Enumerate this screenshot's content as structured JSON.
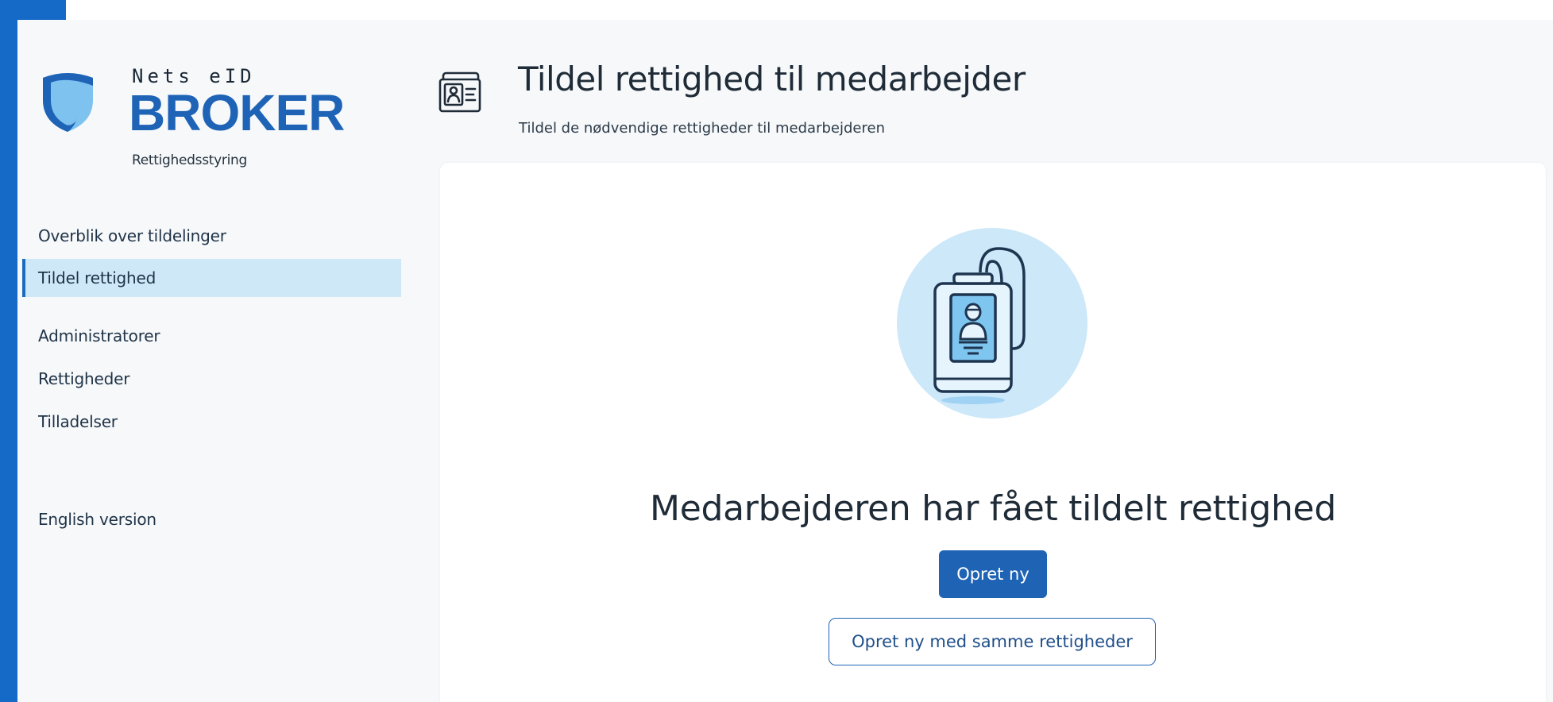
{
  "logo": {
    "top_text": "Nets eID",
    "main_text": "BROKER",
    "sub_text": "Rettighedsstyring",
    "icon": "shield-icon"
  },
  "sidebar": {
    "items": [
      {
        "label": "Overblik over tildelinger",
        "active": false
      },
      {
        "label": "Tildel rettighed",
        "active": true
      },
      {
        "label": "Administratorer",
        "active": false
      },
      {
        "label": "Rettigheder",
        "active": false
      },
      {
        "label": "Tilladelser",
        "active": false
      },
      {
        "label": "English version",
        "active": false
      }
    ]
  },
  "header": {
    "icon": "id-card-icon",
    "title": "Tildel rettighed til medarbejder",
    "subtitle": "Tildel de nødvendige rettigheder til medarbejderen"
  },
  "card": {
    "illustration": "id-badge-icon",
    "message": "Medarbejderen har fået tildelt rettighed",
    "primary_button": "Opret ny",
    "secondary_button": "Opret ny med samme rettigheder"
  },
  "colors": {
    "accent": "#1f63b4",
    "edge": "#1569c7",
    "nav_active_bg": "#cfe8f7",
    "app_bg": "#f6f8fa"
  }
}
